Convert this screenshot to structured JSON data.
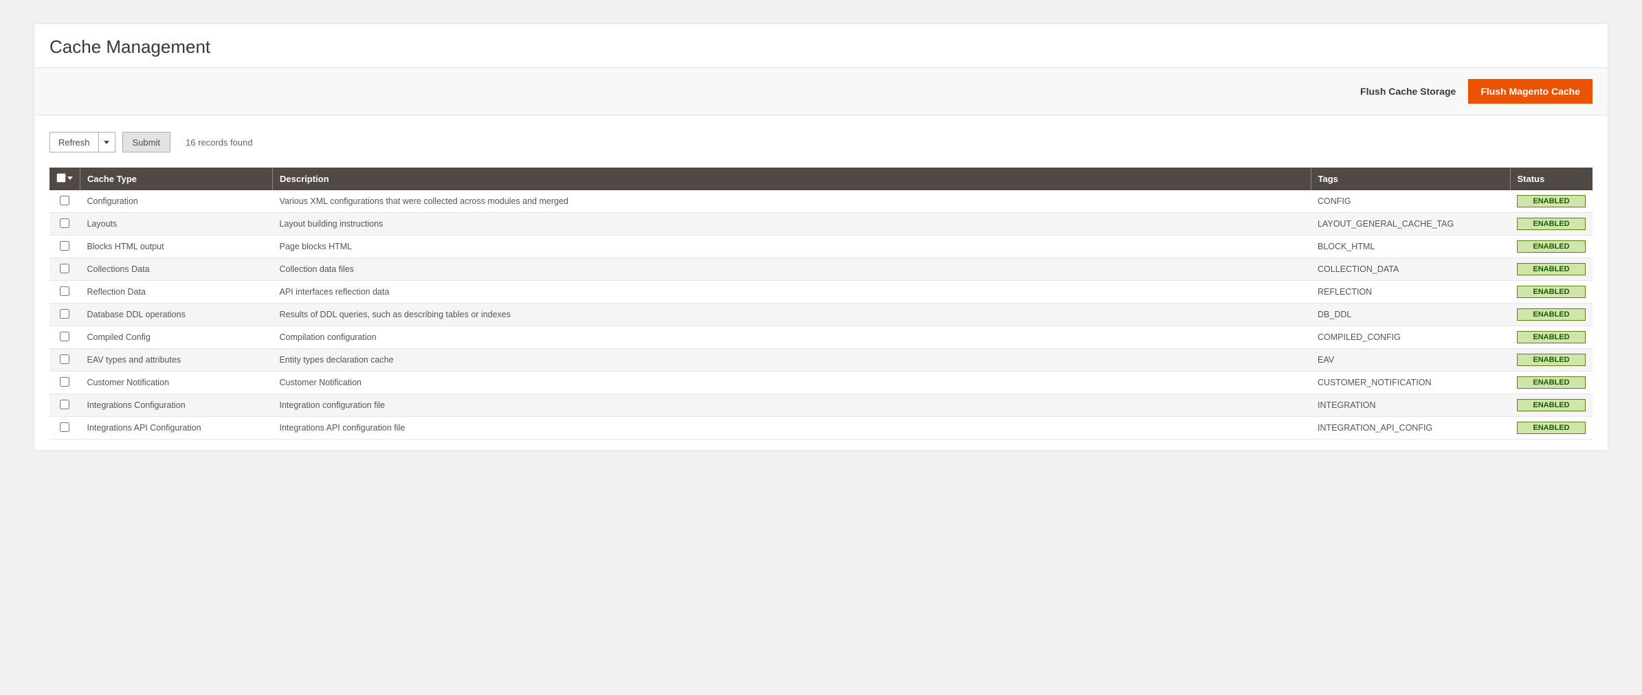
{
  "page": {
    "title": "Cache Management"
  },
  "actions": {
    "flush_storage": "Flush Cache Storage",
    "flush_magento": "Flush Magento Cache"
  },
  "toolbar": {
    "mass_action": "Refresh",
    "submit": "Submit",
    "records_found": "16 records found"
  },
  "table": {
    "headers": {
      "cache_type": "Cache Type",
      "description": "Description",
      "tags": "Tags",
      "status": "Status"
    },
    "status_label": "ENABLED",
    "rows": [
      {
        "type": "Configuration",
        "desc": "Various XML configurations that were collected across modules and merged",
        "tags": "CONFIG"
      },
      {
        "type": "Layouts",
        "desc": "Layout building instructions",
        "tags": "LAYOUT_GENERAL_CACHE_TAG"
      },
      {
        "type": "Blocks HTML output",
        "desc": "Page blocks HTML",
        "tags": "BLOCK_HTML"
      },
      {
        "type": "Collections Data",
        "desc": "Collection data files",
        "tags": "COLLECTION_DATA"
      },
      {
        "type": "Reflection Data",
        "desc": "API interfaces reflection data",
        "tags": "REFLECTION"
      },
      {
        "type": "Database DDL operations",
        "desc": "Results of DDL queries, such as describing tables or indexes",
        "tags": "DB_DDL"
      },
      {
        "type": "Compiled Config",
        "desc": "Compilation configuration",
        "tags": "COMPILED_CONFIG"
      },
      {
        "type": "EAV types and attributes",
        "desc": "Entity types declaration cache",
        "tags": "EAV"
      },
      {
        "type": "Customer Notification",
        "desc": "Customer Notification",
        "tags": "CUSTOMER_NOTIFICATION"
      },
      {
        "type": "Integrations Configuration",
        "desc": "Integration configuration file",
        "tags": "INTEGRATION"
      },
      {
        "type": "Integrations API Configuration",
        "desc": "Integrations API configuration file",
        "tags": "INTEGRATION_API_CONFIG"
      }
    ]
  }
}
